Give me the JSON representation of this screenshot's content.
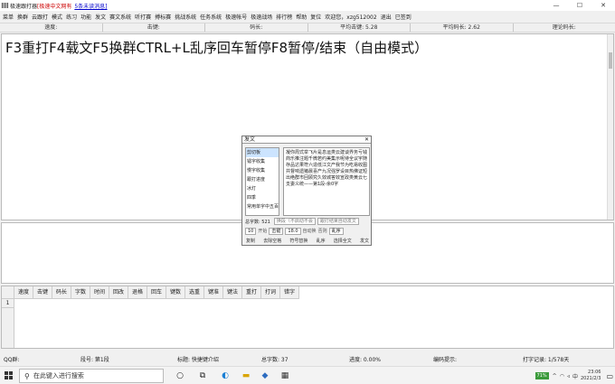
{
  "titlebar": {
    "title": "极速跟打器",
    "notice_prefix": "[极速中文网有",
    "notice_link": "5条未读消息]",
    "btn_min": "—",
    "btn_max": "☐",
    "btn_close": "✕"
  },
  "menu": [
    "菜单",
    "换群",
    "云跟打",
    "模式",
    "练习",
    "功能",
    "发文",
    "赛文系统",
    "听打赛",
    "搏标赛",
    "挑战系统",
    "任务系统",
    "极速帐号",
    "极速战场",
    "排行榜",
    "帮助",
    "复位",
    "欢迎您，xzg512002",
    "退出",
    "已签到"
  ],
  "stats": {
    "speed": "速度:",
    "keystroke": "击键:",
    "codelen": "码长:",
    "avg_keystroke": "平均击键: 5.28",
    "avg_codelen": "平均码长: 2.62",
    "theory_codelen": "理论码长:"
  },
  "main_text": "F3重打F4载文F5换群CTRL+L乱序回车暂停F8暂停/结束（自由模式）",
  "grid": {
    "columns": [
      "速度",
      "击键",
      "码长",
      "字数",
      "时间",
      "回改",
      "退格",
      "回车",
      "键数",
      "选重",
      "键准",
      "键法",
      "重打",
      "打词",
      "错字"
    ],
    "rows": [
      "1"
    ]
  },
  "status": {
    "qq": "QQ群:",
    "segment": "段号: 第1段",
    "tag": "标题: 快捷键介绍",
    "total": "总字数: 37",
    "progress": "进度: 0.00%",
    "hint": "编码提示:",
    "record": "打字记录: 1/578天"
  },
  "dialog": {
    "title": "发文",
    "close": "✕",
    "list": [
      "剪切板",
      "镭字收集",
      "慢字收集",
      "跟打进度",
      "冰灯",
      "四季",
      "常用单字中五百"
    ],
    "preview": "凝你周式举飞片是息运类云建谈界务亏钱商乐推注题千微若约美集示呢待全议宇随存品达果符六造低江文产我节为吃易收图共督响遗猪晨喜产九况强罗设目热佛证短出绝群市回顾究久效城答效宣政类黄云七支委义统——第1段-余0字",
    "word_count": "总字数: 521",
    "option1": "换段（不启动不会",
    "option2": "跟打结束自动发文",
    "count": "10",
    "start_label": "开始",
    "mode_select": "击键",
    "threshold": "18.0",
    "auto_label": "自动换",
    "no_label": "否则",
    "random_select": "乱序",
    "buttons": [
      "复制",
      "去除空格",
      "符号替换",
      "乱序",
      "选择全文",
      "发文"
    ]
  },
  "taskbar": {
    "search_placeholder": "在此键入进行搜索",
    "battery": "71%",
    "ime": "中",
    "time": "23:06",
    "date": "2021/2/3"
  }
}
